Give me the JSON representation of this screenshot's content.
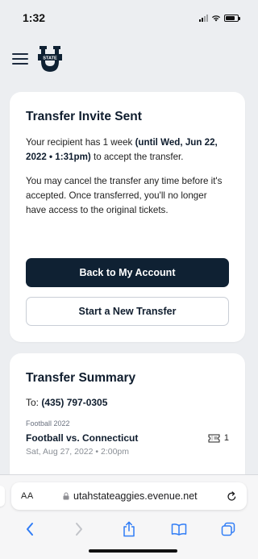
{
  "status": {
    "time": "1:32"
  },
  "header": {
    "logo_text": "STATE"
  },
  "invite": {
    "title": "Transfer Invite Sent",
    "p1_pre": "Your recipient has 1 week ",
    "p1_bold": "(until Wed, Jun 22, 2022 • 1:31pm)",
    "p1_post": " to accept the transfer.",
    "p2": "You may cancel the transfer any time before it's accepted. Once transferred, you'll no longer have access to the original tickets.",
    "back_button": "Back to My Account",
    "new_transfer_button": "Start a New Transfer"
  },
  "summary": {
    "title": "Transfer Summary",
    "to_label": "To: ",
    "to_value": "(435) 797-0305",
    "season": "Football 2022",
    "event_name": "Football vs. Connecticut",
    "ticket_count": "1",
    "event_date": "Sat, Aug 27, 2022 • 2:00pm"
  },
  "browser": {
    "aa_label": "AA",
    "url": "utahstateaggies.evenue.net"
  },
  "colors": {
    "navy": "#0f2133",
    "page_bg": "#eceef1",
    "safari_blue": "#2f7cf6"
  }
}
